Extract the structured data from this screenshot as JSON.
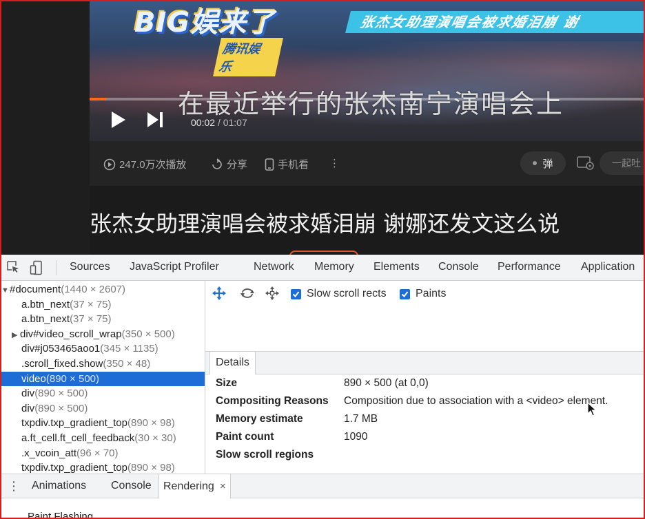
{
  "video": {
    "logo_text": "BIG娱来了",
    "logo_badge": "腾讯娱乐",
    "banner_text": "张杰女助理演唱会被求婚泪崩  谢",
    "subtitle": "在最近举行的张杰南宁演唱会上",
    "current_time": "00:02",
    "duration": "/ 01:07",
    "progress_fraction": 0.03
  },
  "info_bar": {
    "plays": "247.0万次播放",
    "share": "分享",
    "mobile": "手机看",
    "more": "⋮",
    "danmu": "弹",
    "danmu_placeholder": "一起吐"
  },
  "page_title": "张杰女助理演唱会被求婚泪崩 谢娜还发文这么说",
  "devtools": {
    "tabs": [
      "Sources",
      "JavaScript Profiler",
      "Network",
      "Memory",
      "Elements",
      "Console",
      "Performance",
      "Application"
    ],
    "tree": [
      {
        "name": "#document",
        "size": "(1440 × 2607)"
      },
      {
        "name": "a.btn_next",
        "size": "(37 × 75)"
      },
      {
        "name": "a.btn_next",
        "size": "(37 × 75)"
      },
      {
        "name": "div#video_scroll_wrap",
        "size": "(350 × 500)"
      },
      {
        "name": "div#j053465aoo1",
        "size": "(345 × 1135)"
      },
      {
        "name": ".scroll_fixed.show",
        "size": "(350 × 48)"
      },
      {
        "name": "video",
        "size": "(890 × 500)"
      },
      {
        "name": "div",
        "size": "(890 × 500)"
      },
      {
        "name": "div",
        "size": "(890 × 500)"
      },
      {
        "name": "txpdiv.txp_gradient_top",
        "size": "(890 × 98)"
      },
      {
        "name": "a.ft_cell.ft_cell_feedback",
        "size": "(30 × 30)"
      },
      {
        "name": ".x_vcoin_att",
        "size": "(96 × 70)"
      },
      {
        "name": "txpdiv.txp_gradient_top",
        "size": "(890 × 98)"
      }
    ],
    "layers_toolbar": {
      "slow_scroll_rects": "Slow scroll rects",
      "paints": "Paints"
    },
    "details_tab": "Details",
    "details": [
      {
        "key": "Size",
        "value": "890 × 500 (at 0,0)"
      },
      {
        "key": "Compositing Reasons",
        "value": "Composition due to association with a <video> element."
      },
      {
        "key": "Memory estimate",
        "value": "1.7 MB"
      },
      {
        "key": "Paint count",
        "value": "1090"
      },
      {
        "key": "Slow scroll regions",
        "value": ""
      }
    ],
    "drawer_tabs": {
      "animations": "Animations",
      "console": "Console",
      "rendering": "Rendering",
      "close": "×"
    },
    "paint_flashing": "Paint Flashing"
  },
  "colors": {
    "selection": "#1e6cd6",
    "progress": "#ff6a1a",
    "border": "#d21f1f"
  }
}
